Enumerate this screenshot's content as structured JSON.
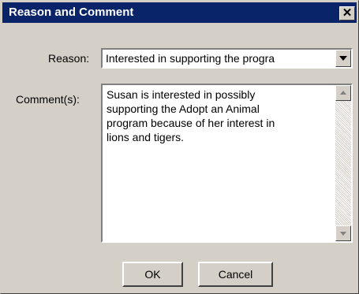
{
  "window": {
    "title": "Reason and Comment",
    "close_glyph": "✕"
  },
  "reason": {
    "label": "Reason:",
    "value": "Interested in supporting the progra"
  },
  "comment": {
    "label": "Comment(s):",
    "value": "Susan is interested in possibly\nsupporting the Adopt an Animal\nprogram because of her interest in\nlions and tigers."
  },
  "buttons": {
    "ok_label": "OK",
    "cancel_label": "Cancel"
  },
  "icons": {
    "dropdown": "chevron-down-icon",
    "scroll_up": "arrow-up-icon",
    "scroll_down": "arrow-down-icon",
    "close": "close-icon"
  },
  "colors": {
    "titlebar": "#0a246a",
    "face": "#d4d0c8"
  }
}
